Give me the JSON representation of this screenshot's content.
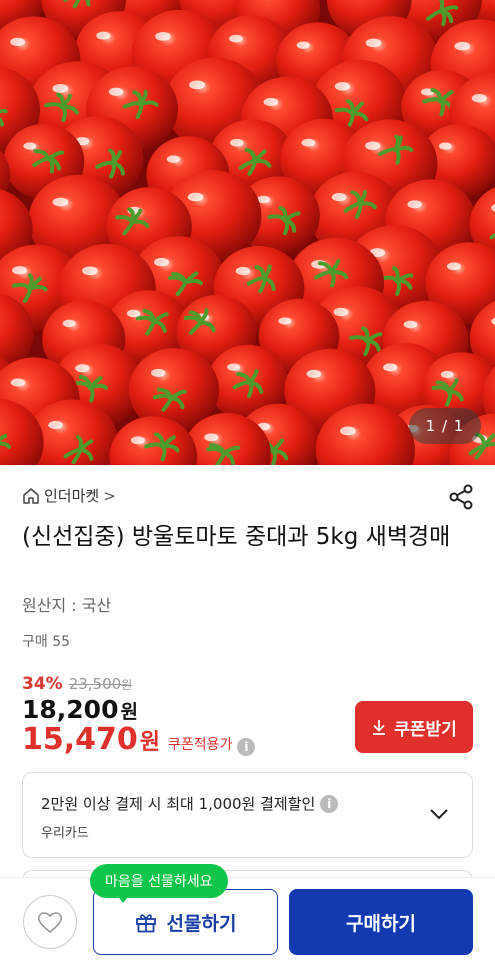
{
  "product": {
    "image_counter": "1 / 1",
    "store_name": "인더마켓",
    "store_chevron": ">",
    "title": "(신선집중) 방울토마토 중대과 5kg 새벽경매",
    "origin": "원산지 : 국산",
    "purchase_count": "구매 55"
  },
  "price": {
    "discount_rate": "34%",
    "original": "23,500",
    "original_unit": "원",
    "sale": "18,200",
    "sale_unit": "원",
    "coupon_price": "15,470",
    "coupon_unit": "원",
    "coupon_label": "쿠폰적용가",
    "info_glyph": "i"
  },
  "coupon_button": {
    "label": "쿠폰받기"
  },
  "card_offer": {
    "line1": "2만원 이상 결제 시 최대 1,000원 결제할인",
    "line2": "우리카드",
    "info_glyph": "i"
  },
  "bottom_bar": {
    "tooltip": "마음을 선물하세요",
    "gift_label": "선물하기",
    "buy_label": "구매하기"
  },
  "colors": {
    "accent_red": "#e0302b",
    "brand_blue": "#1139b0",
    "tooltip_green": "#10c64a"
  },
  "icons": {
    "home": "home-icon",
    "share": "share-icon",
    "download": "download-icon",
    "chevron": "chevron-down-icon",
    "heart": "heart-icon",
    "gift": "gift-icon"
  }
}
